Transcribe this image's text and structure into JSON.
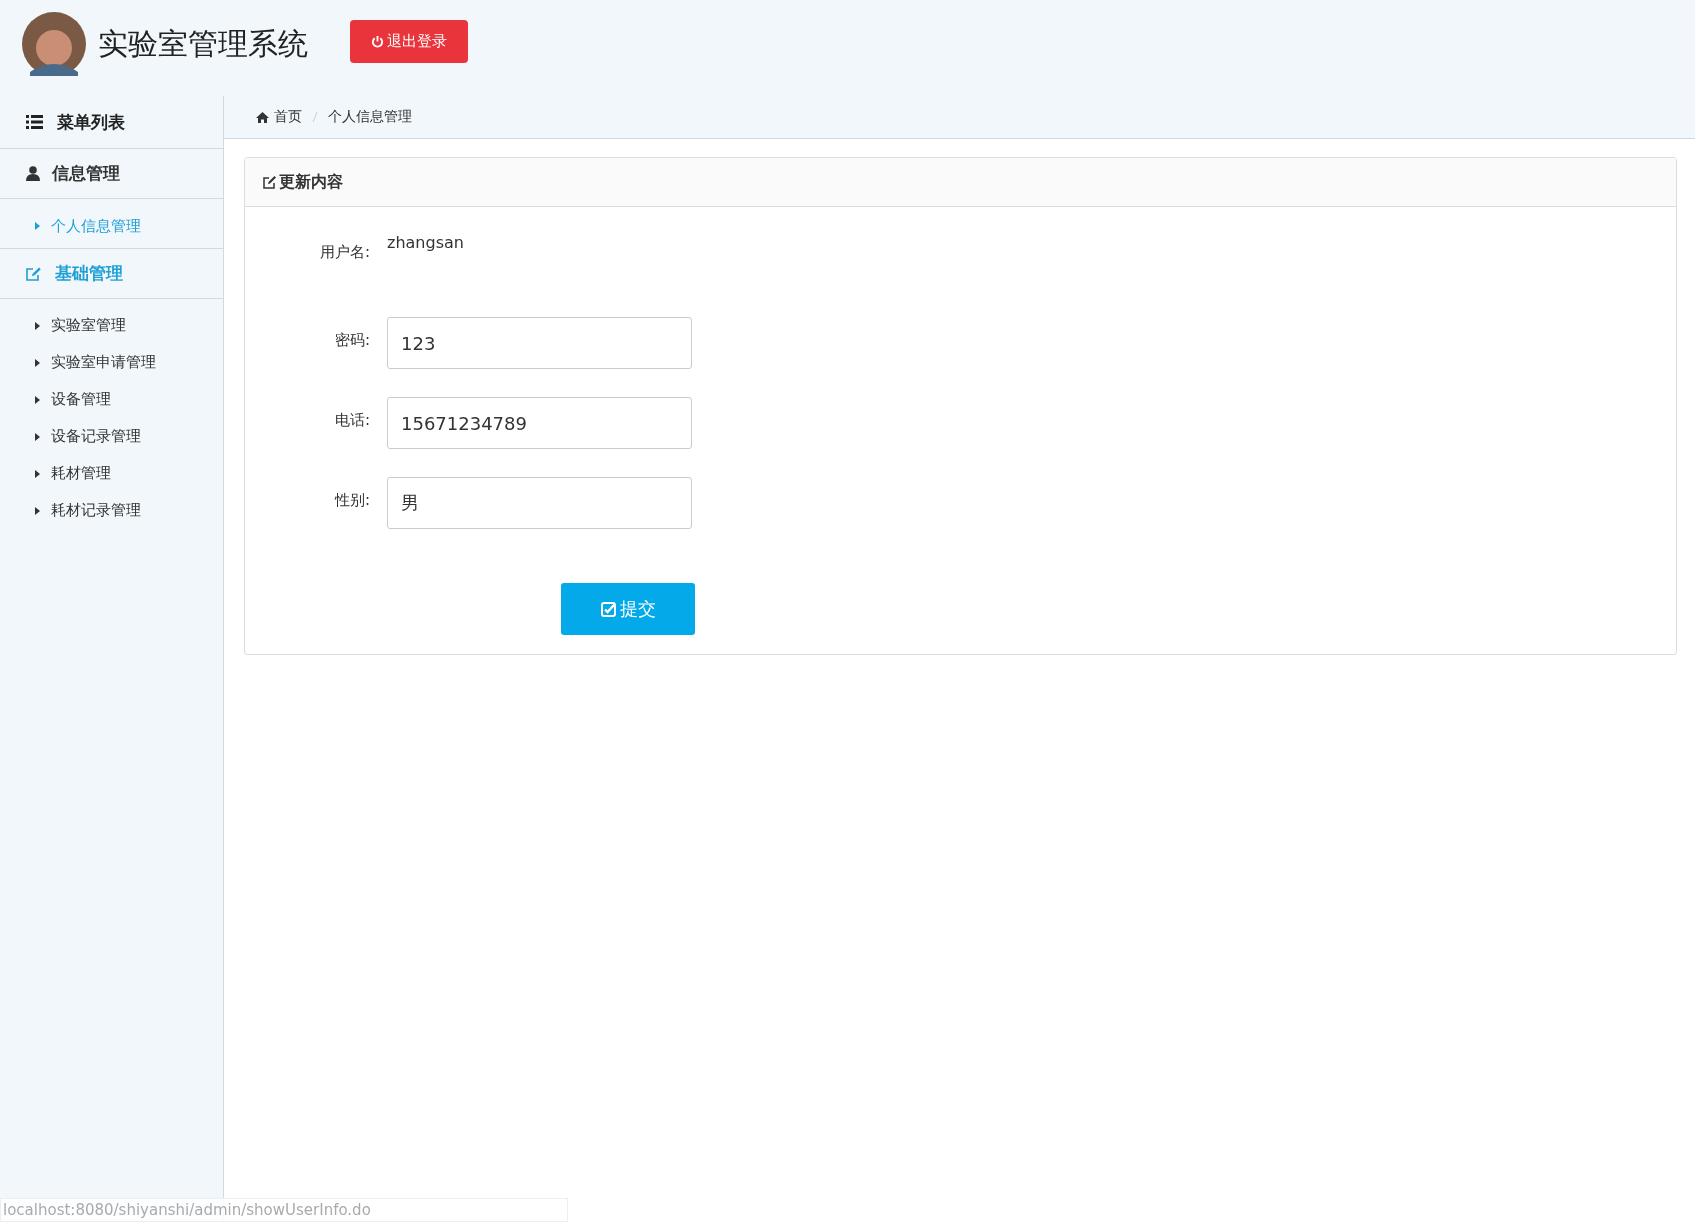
{
  "header": {
    "title": "实验室管理系统",
    "logout_button": "退出登录"
  },
  "sidebar": {
    "title": "菜单列表",
    "groups": [
      {
        "label": "信息管理",
        "selected": false,
        "items": [
          {
            "label": "个人信息管理",
            "selected": true
          }
        ]
      },
      {
        "label": "基础管理",
        "selected": true,
        "items": [
          {
            "label": "实验室管理",
            "selected": false
          },
          {
            "label": "实验室申请管理",
            "selected": false
          },
          {
            "label": "设备管理",
            "selected": false
          },
          {
            "label": "设备记录管理",
            "selected": false
          },
          {
            "label": "耗材管理",
            "selected": false
          },
          {
            "label": "耗材记录管理",
            "selected": false
          }
        ]
      }
    ]
  },
  "breadcrumb": [
    "首页",
    "个人信息管理"
  ],
  "panel": {
    "title": "更新内容",
    "fields": [
      {
        "kind": "static",
        "label": "用户名:",
        "value": "zhangsan"
      },
      {
        "kind": "input",
        "label": "密码:",
        "value": "123"
      },
      {
        "kind": "input",
        "label": "电话:",
        "value": "15671234789"
      },
      {
        "kind": "input",
        "label": "性别:",
        "value": "男"
      }
    ],
    "submit_button": "提交"
  },
  "status_bar": {
    "url": "localhost:8080/shiyanshi/admin/showUserInfo.do"
  }
}
